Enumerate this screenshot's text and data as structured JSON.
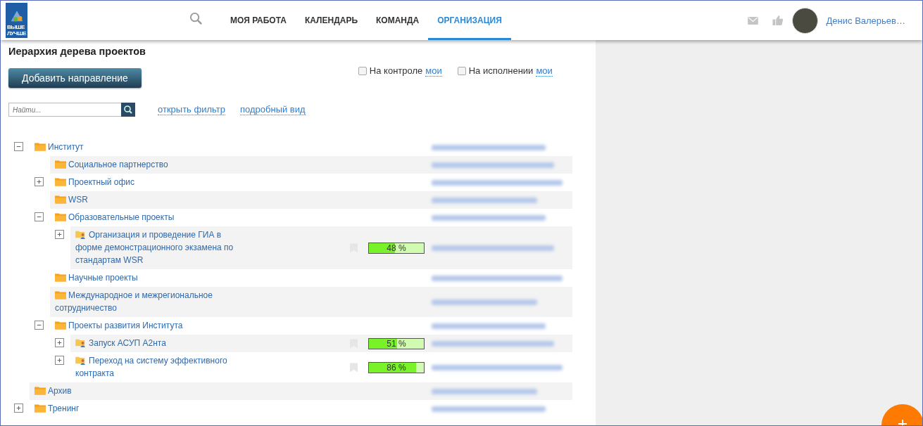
{
  "logo": {
    "lines": [
      "ВЫШЕ",
      "ЛУЧШЕ"
    ]
  },
  "nav": [
    {
      "label": "МОЯ РАБОТА",
      "selected": false
    },
    {
      "label": "КАЛЕНДАРЬ",
      "selected": false
    },
    {
      "label": "КОМАНДА",
      "selected": false
    },
    {
      "label": "ОРГАНИЗАЦИЯ",
      "selected": true
    }
  ],
  "user": {
    "name": "Денис Валерьев…"
  },
  "page": {
    "title": "Иерархия дерева проектов",
    "add_button": "Добавить направление",
    "filters": [
      {
        "label": "На контроле",
        "link": "мои",
        "checked": false
      },
      {
        "label": "На исполнении",
        "link": "мои",
        "checked": false
      }
    ],
    "search": {
      "placeholder": "Найти..."
    },
    "links": [
      "открыть фильтр",
      "подробный вид"
    ]
  },
  "tree": [
    {
      "kind": "folder",
      "title": "Институт",
      "expanded": true,
      "children": [
        {
          "kind": "folder",
          "title": "Социальное партнерство"
        },
        {
          "kind": "folder",
          "title": "Проектный офис",
          "expanded": false
        },
        {
          "kind": "folder",
          "title": "WSR"
        },
        {
          "kind": "folder",
          "title": "Образовательные проекты",
          "expanded": true,
          "children": [
            {
              "kind": "project",
              "title": "Организация и проведение ГИА в форме демонстрационного экзамена по стандартам WSR",
              "expanded": false,
              "level": 0.48,
              "reading": "48 %"
            }
          ]
        },
        {
          "kind": "folder",
          "title": "Научные проекты"
        },
        {
          "kind": "folder",
          "title": "Международное и межрегиональное сотрудничество"
        },
        {
          "kind": "folder",
          "title": "Проекты развития Института",
          "expanded": true,
          "children": [
            {
              "kind": "project",
              "title": "Запуск АСУП А2нта",
              "expanded": false,
              "level": 0.51,
              "reading": "51 %"
            },
            {
              "kind": "project",
              "title": "Переход на систему эффективного контракта",
              "expanded": false,
              "level": 0.86,
              "reading": "86 %"
            }
          ]
        }
      ]
    },
    {
      "kind": "folder",
      "title": "Архив"
    },
    {
      "kind": "folder",
      "title": "Тренинг",
      "expanded": false
    }
  ]
}
